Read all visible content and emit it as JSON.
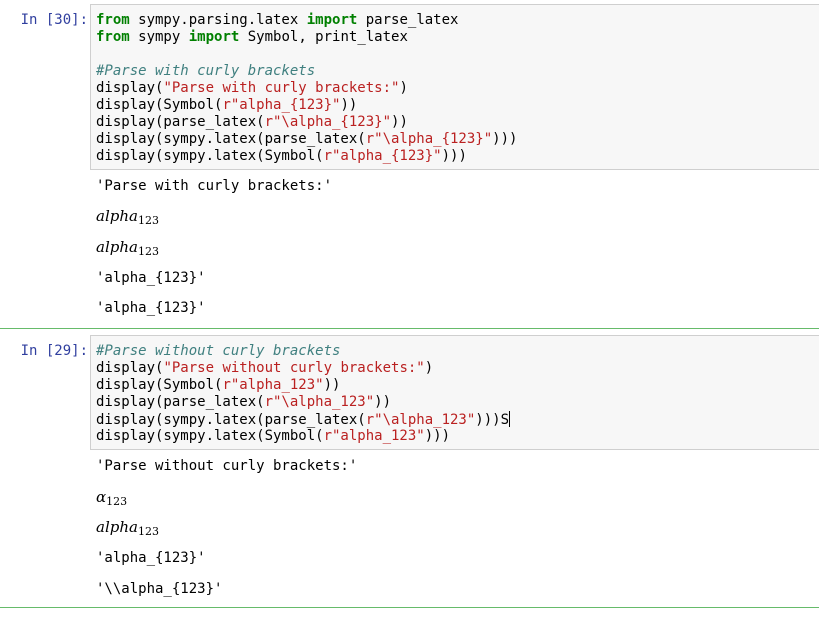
{
  "cells": [
    {
      "prompt": "In [30]:",
      "code": {
        "l1_kw1": "from",
        "l1_mid": " sympy.parsing.latex ",
        "l1_kw2": "import",
        "l1_end": " parse_latex",
        "l2_kw1": "from",
        "l2_mid": " sympy ",
        "l2_kw2": "import",
        "l2_end": " Symbol, print_latex",
        "l4_comment": "#Parse with curly brackets",
        "l5_a": "display(",
        "l5_s": "\"Parse with curly brackets:\"",
        "l5_b": ")",
        "l6_a": "display(Symbol(",
        "l6_s": "r\"alpha_{123}\"",
        "l6_b": "))",
        "l7_a": "display(parse_latex(",
        "l7_s": "r\"\\alpha_{123}\"",
        "l7_b": "))",
        "l8_a": "display(sympy.latex(parse_latex(",
        "l8_s": "r\"\\alpha_{123}\"",
        "l8_b": ")))",
        "l9_a": "display(sympy.latex(Symbol(",
        "l9_s": "r\"alpha_{123}\"",
        "l9_b": ")))"
      },
      "outputs": {
        "o1": "'Parse with curly brackets:'",
        "o2_base": "alpha",
        "o2_sub": "123",
        "o3_base": "alpha",
        "o3_sub": "123",
        "o4": "'alpha_{123}'",
        "o5": "'alpha_{123}'"
      }
    },
    {
      "prompt": "In [29]:",
      "code": {
        "l1_comment": "#Parse without curly brackets",
        "l2_a": "display(",
        "l2_s": "\"Parse without curly brackets:\"",
        "l2_b": ")",
        "l3_a": "display(Symbol(",
        "l3_s": "r\"alpha_123\"",
        "l3_b": "))",
        "l4_a": "display(parse_latex(",
        "l4_s": "r\"\\alpha_123\"",
        "l4_b": "))",
        "l5_a": "display(sympy.latex(parse_latex(",
        "l5_s": "r\"\\alpha_123\"",
        "l5_b": ")))S",
        "l6_a": "display(sympy.latex(Symbol(",
        "l6_s": "r\"alpha_123\"",
        "l6_b": ")))"
      },
      "outputs": {
        "o1": "'Parse without curly brackets:'",
        "o2_base": "α",
        "o2_sub": "123",
        "o3_base": "alpha",
        "o3_sub": "123",
        "o4": "'alpha_{123}'",
        "o5": "'\\\\alpha_{123}'"
      }
    }
  ],
  "colors": {
    "prompt": "#303f9f",
    "keyword": "#008000",
    "comment": "#408080",
    "string": "#ba2121",
    "cell_border": "#66bb6a"
  }
}
